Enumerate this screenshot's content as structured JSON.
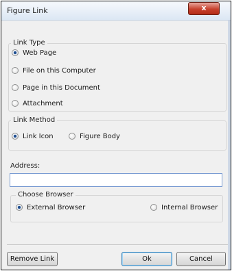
{
  "window": {
    "title": "Figure Link",
    "close_glyph": "x"
  },
  "link_type": {
    "legend": "Link Type",
    "options": [
      {
        "label": "Web Page",
        "checked": true
      },
      {
        "label": "File on this Computer",
        "checked": false
      },
      {
        "label": "Page in this Document",
        "checked": false
      },
      {
        "label": "Attachment",
        "checked": false
      }
    ]
  },
  "link_method": {
    "legend": "Link Method",
    "options": [
      {
        "label": "Link Icon",
        "checked": true
      },
      {
        "label": "Figure Body",
        "checked": false
      }
    ]
  },
  "address": {
    "label": "Address:",
    "value": ""
  },
  "browser": {
    "legend": "Choose Browser",
    "options": [
      {
        "label": "External Browser",
        "checked": true
      },
      {
        "label": "Internal Browser",
        "checked": false
      }
    ]
  },
  "buttons": {
    "remove_link": "Remove Link",
    "ok": "Ok",
    "cancel": "Cancel"
  }
}
